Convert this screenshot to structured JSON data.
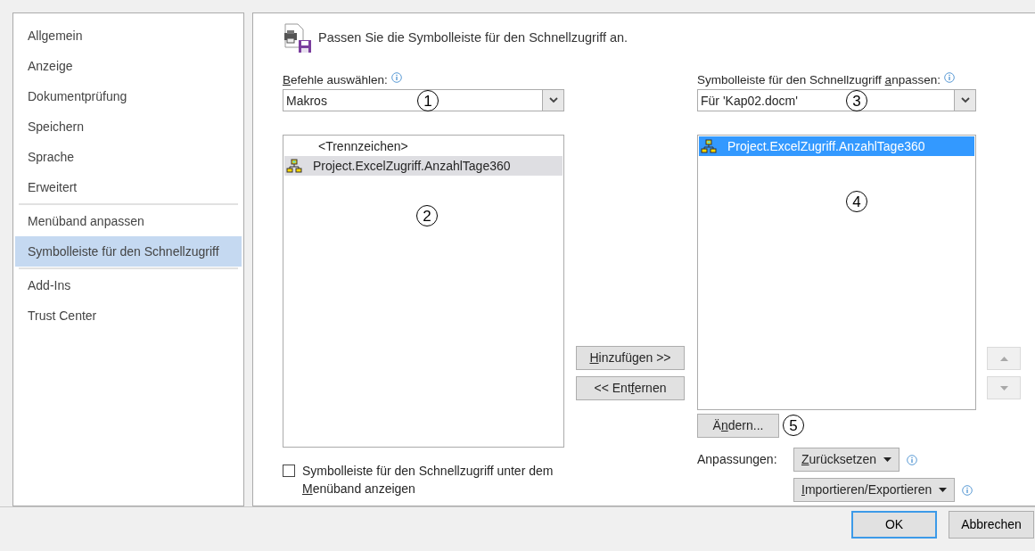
{
  "sidebar": {
    "items": [
      {
        "label": "Allgemein",
        "selected": false,
        "separator_after": false
      },
      {
        "label": "Anzeige",
        "selected": false,
        "separator_after": false
      },
      {
        "label": "Dokumentprüfung",
        "selected": false,
        "separator_after": false
      },
      {
        "label": "Speichern",
        "selected": false,
        "separator_after": false
      },
      {
        "label": "Sprache",
        "selected": false,
        "separator_after": false
      },
      {
        "label": "Erweitert",
        "selected": false,
        "separator_after": true
      },
      {
        "label": "Menüband anpassen",
        "selected": false,
        "separator_after": false
      },
      {
        "label": "Symbolleiste für den Schnellzugriff",
        "selected": true,
        "separator_after": true
      },
      {
        "label": "Add-Ins",
        "selected": false,
        "separator_after": false
      },
      {
        "label": "Trust Center",
        "selected": false,
        "separator_after": false
      }
    ]
  },
  "heading": "Passen Sie die Symbolleiste für den Schnellzugriff an.",
  "commands": {
    "label": {
      "key": "B",
      "after": "efehle auswählen:"
    },
    "value": "Makros",
    "callout": "1",
    "list": {
      "callout": "2",
      "items": [
        {
          "label": "<Trennzeichen>",
          "kind": "separator",
          "selected": false
        },
        {
          "label": "Project.ExcelZugriff.AnzahlTage360",
          "kind": "macro",
          "selected": true
        }
      ]
    }
  },
  "move_buttons": [
    {
      "label": {
        "key": "H",
        "after": "inzufügen >>"
      }
    },
    {
      "label": {
        "before": "<< Ent",
        "key": "f",
        "after": "ernen"
      }
    }
  ],
  "toolbar": {
    "label": {
      "before": "Symbolleiste für den Schnellzugriff ",
      "key": "a",
      "after": "npassen:"
    },
    "value": "Für 'Kap02.docm'",
    "callout": "3",
    "list": {
      "callout": "4",
      "items": [
        {
          "label": "Project.ExcelZugriff.AnzahlTage360",
          "kind": "macro",
          "selected": true
        }
      ]
    }
  },
  "order_buttons": [
    {
      "kind": "up",
      "disabled": true
    },
    {
      "kind": "down",
      "disabled": true
    }
  ],
  "modify_button": {
    "label": {
      "before": "Ä",
      "key": "n",
      "after": "dern..."
    },
    "callout": "5"
  },
  "show_below": {
    "checked": false,
    "label": {
      "before": "Symbolleiste für den Schnellzugriff unter dem ",
      "key": "M",
      "after": "enüband anzeigen"
    }
  },
  "customizations": {
    "label": "Anpassungen:",
    "buttons": [
      {
        "label": {
          "key": "Z",
          "after": "urücksetzen"
        }
      },
      {
        "label": {
          "key": "I",
          "after": "mportieren/Exportieren"
        }
      }
    ]
  },
  "footer": [
    {
      "label": "OK",
      "default": true
    },
    {
      "label": "Abbrechen",
      "default": false
    }
  ]
}
